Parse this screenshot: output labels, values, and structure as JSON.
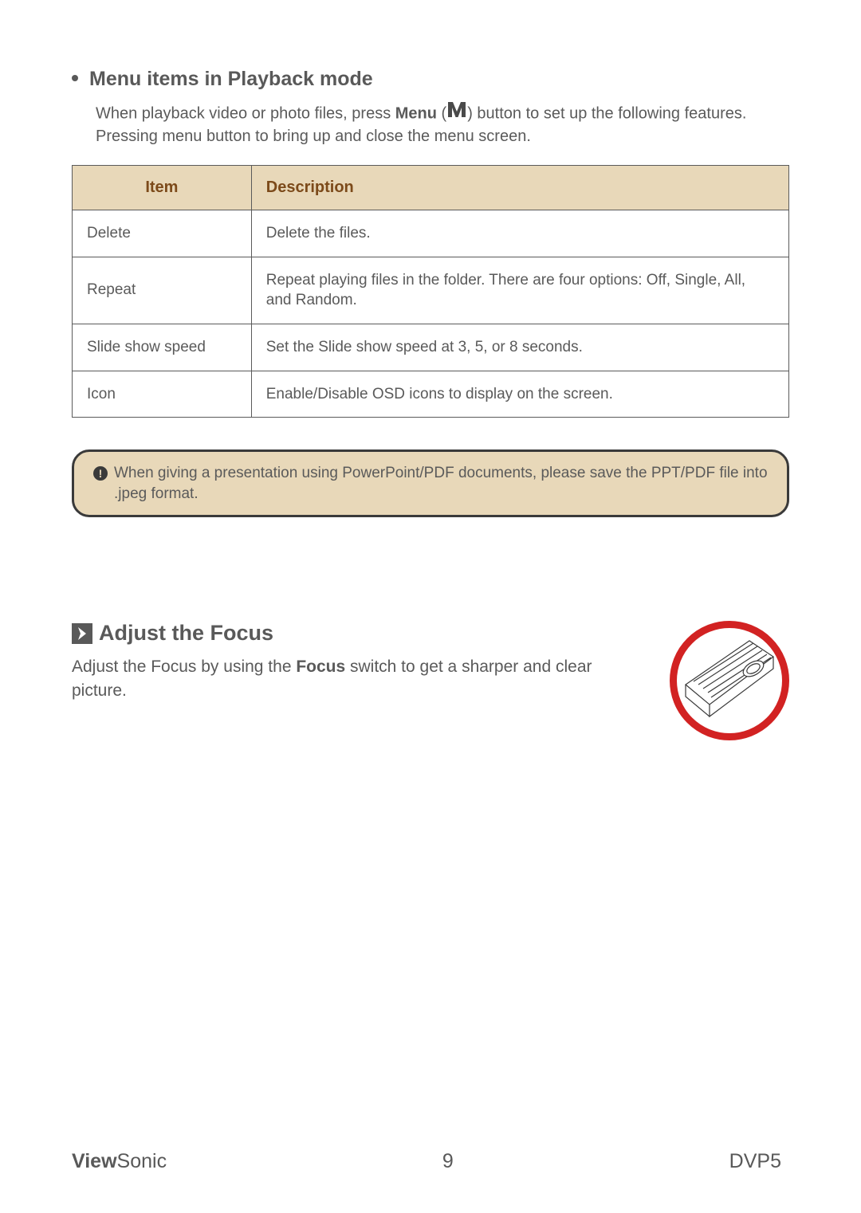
{
  "section1": {
    "heading": "Menu items in Playback mode",
    "intro_prefix": "When playback video or photo files, press ",
    "intro_bold": "Menu",
    "intro_after_icon": " button to set up the following features. Pressing menu button to bring up and close the menu screen.",
    "table": {
      "headers": {
        "item": "Item",
        "desc": "Description"
      },
      "rows": [
        {
          "item": "Delete",
          "desc": "Delete the files."
        },
        {
          "item": "Repeat",
          "desc": "Repeat playing files in the folder. There are four options: Off, Single, All, and Random."
        },
        {
          "item": "Slide show speed",
          "desc": "Set the Slide show speed at 3, 5, or 8 seconds."
        },
        {
          "item": "Icon",
          "desc": "Enable/Disable OSD icons to display on the screen."
        }
      ]
    },
    "note": "When giving a presentation using PowerPoint/PDF documents, please save the PPT/PDF file into .jpeg format."
  },
  "section2": {
    "heading": "Adjust the Focus",
    "para_prefix": "Adjust the Focus by using the ",
    "para_bold": "Focus",
    "para_suffix": " switch to get a sharper and clear picture."
  },
  "footer": {
    "brand_bold": "View",
    "brand_rest": "Sonic",
    "page_number": "9",
    "model": "DVP5"
  },
  "icons": {
    "info_glyph": "!"
  }
}
